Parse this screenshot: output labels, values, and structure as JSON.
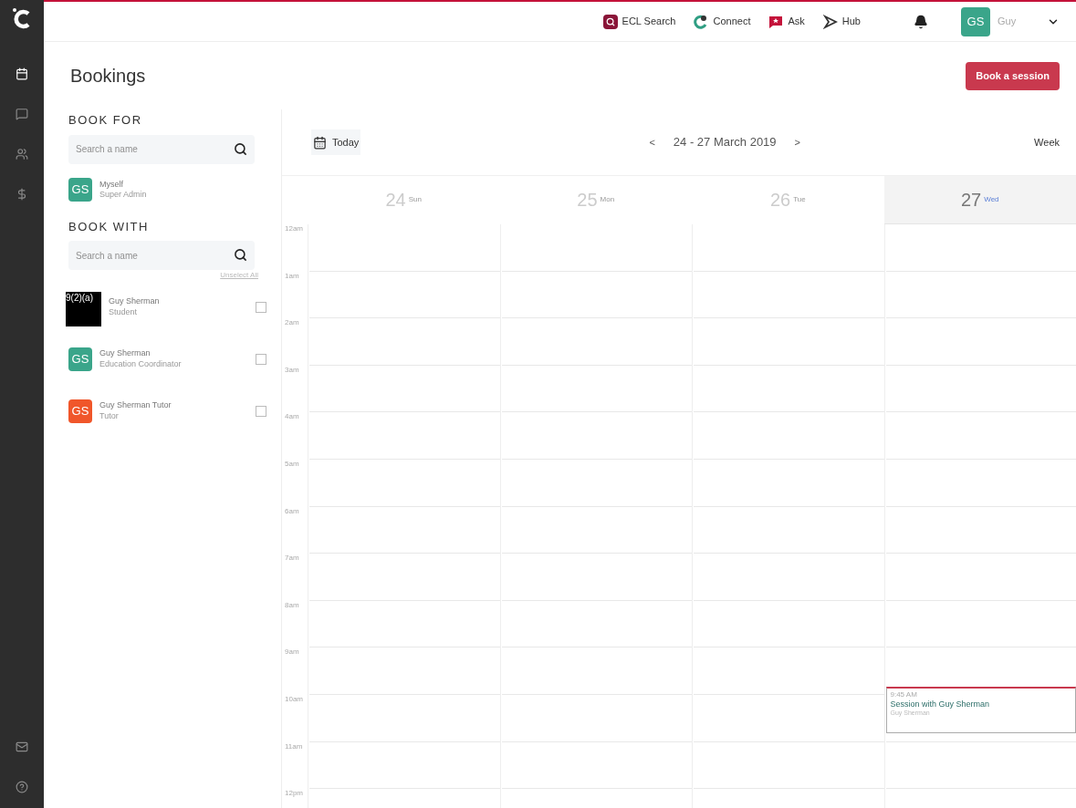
{
  "side_nav": {
    "items": [
      {
        "selected": true
      },
      {
        "selected": false
      },
      {
        "selected": false
      },
      {
        "selected": false
      }
    ]
  },
  "top_nav": {
    "links": [
      {
        "label": "ECL Search"
      },
      {
        "label": "Connect"
      },
      {
        "label": "Ask"
      },
      {
        "label": "Hub"
      }
    ],
    "user": {
      "initials": "GS",
      "name": "Guy"
    }
  },
  "page": {
    "title": "Bookings",
    "primary_button": "Book a session"
  },
  "book_for": {
    "heading": "BOOK FOR",
    "search_placeholder": "Search a name",
    "people": [
      {
        "kind": "avatar",
        "initials": "GS",
        "color": "#3aa58a",
        "name": "Myself",
        "role": "Super Admin"
      }
    ]
  },
  "book_with": {
    "heading": "BOOK WITH",
    "search_placeholder": "Search a name",
    "unselect_all": "Unselect All",
    "people": [
      {
        "kind": "redacted",
        "redaction": "9(2)(a)",
        "name": "Guy Sherman",
        "role": "Student",
        "checked": false
      },
      {
        "kind": "avatar",
        "initials": "GS",
        "color": "#3aa58a",
        "name": "Guy Sherman",
        "role": "Education Coordinator",
        "checked": false
      },
      {
        "kind": "avatar",
        "initials": "GS",
        "color": "#f0562a",
        "name": "Guy Sherman Tutor",
        "role": "Tutor",
        "checked": false
      }
    ]
  },
  "calendar": {
    "today_button": "Today",
    "prev": "<",
    "range": "24 - 27 March 2019",
    "next": ">",
    "view": "Week",
    "days": [
      {
        "date": "24",
        "weekday": "Sun",
        "selected": false
      },
      {
        "date": "25",
        "weekday": "Mon",
        "selected": false
      },
      {
        "date": "26",
        "weekday": "Tue",
        "selected": false
      },
      {
        "date": "27",
        "weekday": "Wed",
        "selected": true,
        "events": [
          {
            "time": "9:45 AM",
            "title": "Session with Guy Sherman",
            "person": "Guy Sherman"
          }
        ]
      }
    ],
    "hours": [
      "12am",
      "1am",
      "2am",
      "3am",
      "4am",
      "5am",
      "6am",
      "7am",
      "8am",
      "9am",
      "10am",
      "11am",
      "12pm"
    ]
  }
}
